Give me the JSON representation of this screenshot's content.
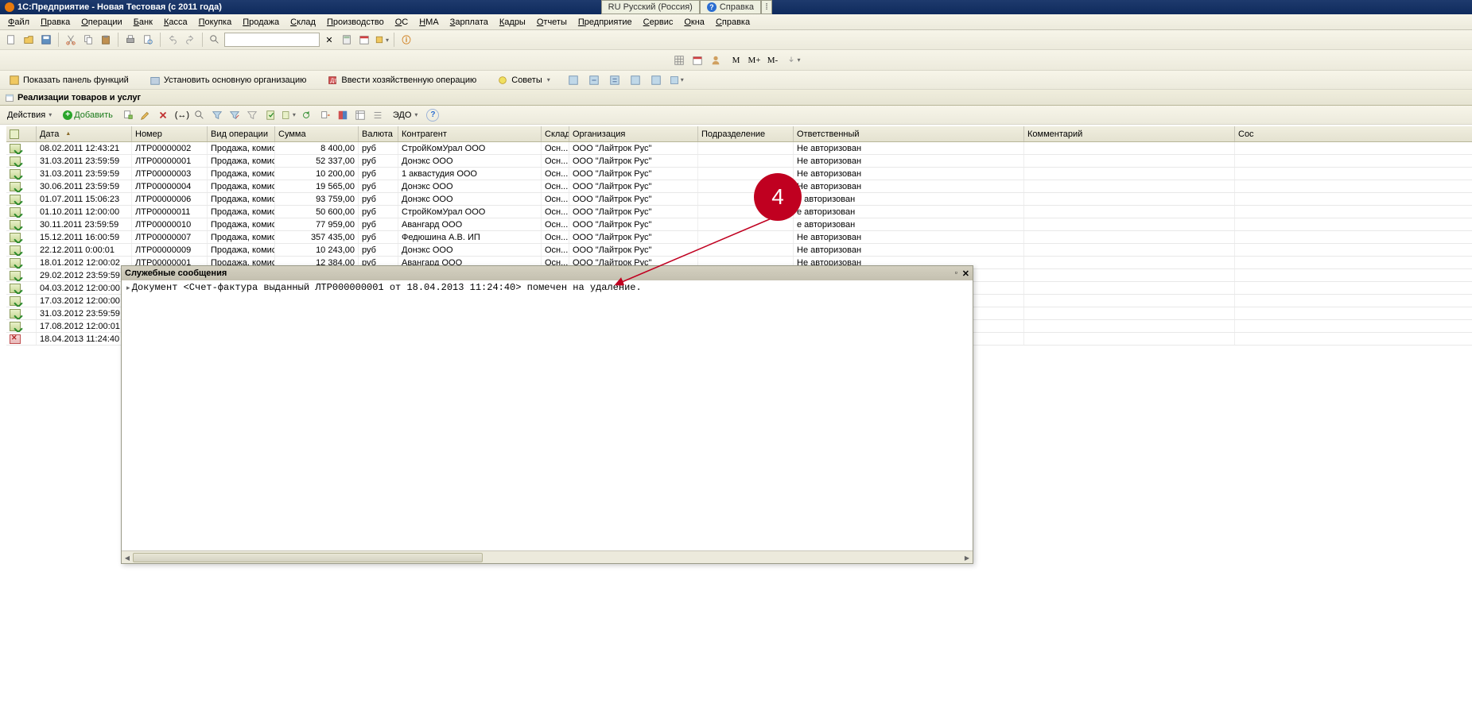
{
  "title": "1С:Предприятие - Новая Тестовая (с 2011 года)",
  "top_tabs": {
    "lang": "RU Русский (Россия)",
    "help": "Справка"
  },
  "menu": [
    "Файл",
    "Правка",
    "Операции",
    "Банк",
    "Касса",
    "Покупка",
    "Продажа",
    "Склад",
    "Производство",
    "ОС",
    "НМА",
    "Зарплата",
    "Кадры",
    "Отчеты",
    "Предприятие",
    "Сервис",
    "Окна",
    "Справка"
  ],
  "funcbar": {
    "show_panel": "Показать панель функций",
    "set_org": "Установить основную организацию",
    "add_op": "Ввести хозяйственную операцию",
    "tips": "Советы"
  },
  "tab_title": "Реализации товаров и услуг",
  "actionbar": {
    "actions": "Действия",
    "add": "Добавить",
    "edo": "ЭДО"
  },
  "columns": {
    "date": "Дата",
    "num": "Номер",
    "op": "Вид операции",
    "sum": "Сумма",
    "cur": "Валюта",
    "kontr": "Контрагент",
    "sklad": "Склад",
    "org": "Организация",
    "podr": "Подразделение",
    "otv": "Ответственный",
    "kom": "Комментарий",
    "sost": "Сос"
  },
  "rows": [
    {
      "date": "08.02.2011 12:43:21",
      "num": "ЛТР00000002",
      "op": "Продажа, комис...",
      "sum": "8 400,00",
      "cur": "руб",
      "kontr": "СтройКомУрал ООО",
      "sklad": "Осн...",
      "org": "ООО \"Лайтрок Рус\"",
      "otv": "Не авторизован",
      "posted": true
    },
    {
      "date": "31.03.2011 23:59:59",
      "num": "ЛТР00000001",
      "op": "Продажа, комис...",
      "sum": "52 337,00",
      "cur": "руб",
      "kontr": "Донэкс ООО",
      "sklad": "Осн...",
      "org": "ООО \"Лайтрок Рус\"",
      "otv": "Не авторизован",
      "posted": true
    },
    {
      "date": "31.03.2011 23:59:59",
      "num": "ЛТР00000003",
      "op": "Продажа, комис...",
      "sum": "10 200,00",
      "cur": "руб",
      "kontr": "1 аквастудия ООО",
      "sklad": "Осн...",
      "org": "ООО \"Лайтрок Рус\"",
      "otv": "Не авторизован",
      "posted": true
    },
    {
      "date": "30.06.2011 23:59:59",
      "num": "ЛТР00000004",
      "op": "Продажа, комис...",
      "sum": "19 565,00",
      "cur": "руб",
      "kontr": "Донэкс ООО",
      "sklad": "Осн...",
      "org": "ООО \"Лайтрок Рус\"",
      "otv": "Не авторизован",
      "posted": true
    },
    {
      "date": "01.07.2011 15:06:23",
      "num": "ЛТР00000006",
      "op": "Продажа, комис...",
      "sum": "93 759,00",
      "cur": "руб",
      "kontr": "Донэкс ООО",
      "sklad": "Осн...",
      "org": "ООО \"Лайтрок Рус\"",
      "otv": "е авторизован",
      "posted": true
    },
    {
      "date": "01.10.2011 12:00:00",
      "num": "ЛТР00000011",
      "op": "Продажа, комис...",
      "sum": "50 600,00",
      "cur": "руб",
      "kontr": "СтройКомУрал ООО",
      "sklad": "Осн...",
      "org": "ООО \"Лайтрок Рус\"",
      "otv": "е авторизован",
      "posted": true
    },
    {
      "date": "30.11.2011 23:59:59",
      "num": "ЛТР00000010",
      "op": "Продажа, комис...",
      "sum": "77 959,00",
      "cur": "руб",
      "kontr": "Авангард ООО",
      "sklad": "Осн...",
      "org": "ООО \"Лайтрок Рус\"",
      "otv": "е авторизован",
      "posted": true
    },
    {
      "date": "15.12.2011 16:00:59",
      "num": "ЛТР00000007",
      "op": "Продажа, комис...",
      "sum": "357 435,00",
      "cur": "руб",
      "kontr": "Федюшина А.В. ИП",
      "sklad": "Осн...",
      "org": "ООО \"Лайтрок Рус\"",
      "otv": "Не авторизован",
      "posted": true
    },
    {
      "date": "22.12.2011 0:00:01",
      "num": "ЛТР00000009",
      "op": "Продажа, комис...",
      "sum": "10 243,00",
      "cur": "руб",
      "kontr": "Донэкс ООО",
      "sklad": "Осн...",
      "org": "ООО \"Лайтрок Рус\"",
      "otv": "Не авторизован",
      "posted": true
    },
    {
      "date": "18.01.2012 12:00:02",
      "num": "ЛТР00000001",
      "op": "Продажа, комис...",
      "sum": "12 384,00",
      "cur": "руб",
      "kontr": "Авангард ООО",
      "sklad": "Осн...",
      "org": "ООО \"Лайтрок Рус\"",
      "otv": "Не авторизован",
      "posted": true
    },
    {
      "date": "29.02.2012 23:59:59",
      "num": "",
      "op": "",
      "sum": "",
      "cur": "",
      "kontr": "",
      "sklad": "",
      "org": "",
      "otv": "",
      "posted": true
    },
    {
      "date": "04.03.2012 12:00:00",
      "num": "",
      "op": "",
      "sum": "",
      "cur": "",
      "kontr": "",
      "sklad": "",
      "org": "",
      "otv": "",
      "posted": true
    },
    {
      "date": "17.03.2012 12:00:00",
      "num": "",
      "op": "",
      "sum": "",
      "cur": "",
      "kontr": "",
      "sklad": "",
      "org": "",
      "otv": "",
      "posted": true
    },
    {
      "date": "31.03.2012 23:59:59",
      "num": "",
      "op": "",
      "sum": "",
      "cur": "",
      "kontr": "",
      "sklad": "",
      "org": "",
      "otv": "",
      "posted": true
    },
    {
      "date": "17.08.2012 12:00:01",
      "num": "",
      "op": "",
      "sum": "",
      "cur": "",
      "kontr": "",
      "sklad": "",
      "org": "",
      "otv": "",
      "posted": true
    },
    {
      "date": "18.04.2013 11:24:40",
      "num": "",
      "op": "",
      "sum": "",
      "cur": "",
      "kontr": "",
      "sklad": "",
      "org": "",
      "otv": "",
      "posted": false,
      "deleted": true
    }
  ],
  "msg_panel": {
    "title": "Служебные сообщения",
    "line": "Документ <Счет-фактура выданный ЛТР000000001 от 18.04.2013 11:24:40> помечен на удаление."
  },
  "annotation": {
    "num": "4"
  },
  "m_buttons": [
    "M",
    "M+",
    "M-"
  ]
}
